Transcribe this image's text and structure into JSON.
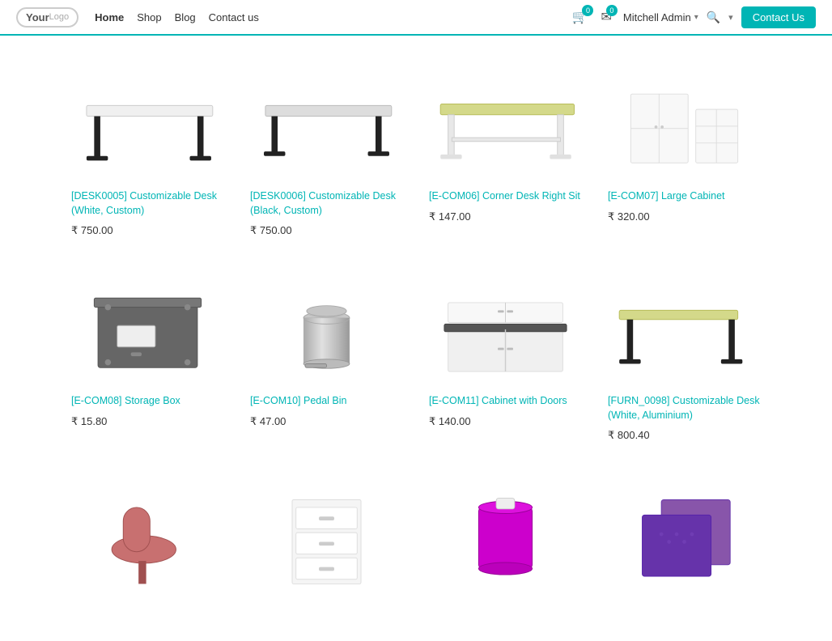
{
  "nav": {
    "logo_your": "Your",
    "logo_logo": "Logo",
    "links": [
      {
        "label": "Home",
        "active": true
      },
      {
        "label": "Shop",
        "active": false
      },
      {
        "label": "Blog",
        "active": false
      },
      {
        "label": "Contact us",
        "active": false
      }
    ],
    "cart_count": "0",
    "mail_count": "0",
    "user": "Mitchell Admin",
    "contact_us_btn": "Contact Us"
  },
  "products": [
    {
      "id": "p1",
      "name": "[DESK0005] Customizable Desk (White, Custom)",
      "price": "₹ 750.00",
      "has_price": true,
      "color": "white_desk"
    },
    {
      "id": "p2",
      "name": "[DESK0006] Customizable Desk (Black, Custom)",
      "price": "₹ 750.00",
      "has_price": true,
      "color": "black_desk"
    },
    {
      "id": "p3",
      "name": "[E-COM06] Corner Desk Right Sit",
      "price": "₹ 147.00",
      "has_price": true,
      "color": "green_desk"
    },
    {
      "id": "p4",
      "name": "[E-COM07] Large Cabinet",
      "price": "₹ 320.00",
      "has_price": true,
      "color": "cabinet"
    },
    {
      "id": "p5",
      "name": "[E-COM08] Storage Box",
      "price": "₹ 15.80",
      "has_price": true,
      "color": "storage_box"
    },
    {
      "id": "p6",
      "name": "[E-COM10] Pedal Bin",
      "price": "₹ 47.00",
      "has_price": true,
      "color": "pedal_bin"
    },
    {
      "id": "p7",
      "name": "[E-COM11] Cabinet with Doors",
      "price": "₹ 140.00",
      "has_price": true,
      "color": "cabinet_doors"
    },
    {
      "id": "p8",
      "name": "[FURN_0098] Customizable Desk (White, Aluminium)",
      "price": "₹ 800.40",
      "has_price": true,
      "color": "green_desk2"
    },
    {
      "id": "p9",
      "name": "",
      "price": "",
      "has_price": false,
      "color": "pink_chair"
    },
    {
      "id": "p10",
      "name": "",
      "price": "",
      "has_price": false,
      "color": "white_cabinet2"
    },
    {
      "id": "p11",
      "name": "",
      "price": "",
      "has_price": false,
      "color": "lamp"
    },
    {
      "id": "p12",
      "name": "",
      "price": "",
      "has_price": false,
      "color": "purple_box"
    }
  ]
}
